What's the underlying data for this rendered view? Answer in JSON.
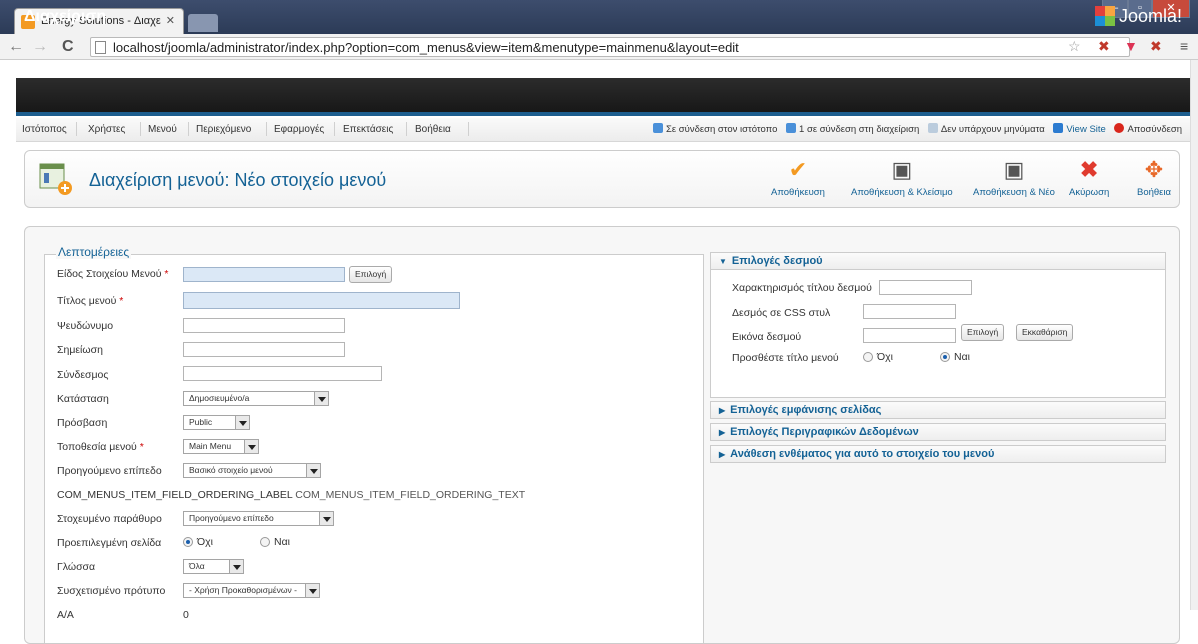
{
  "browser": {
    "tab_title": "Energy Solutions - Διαχείρ",
    "url": "localhost/joomla/administrator/index.php?option=com_menus&view=item&menutype=mainmenu&layout=edit"
  },
  "header": {
    "title": "Διαχείριση",
    "logo_text": "Joomla!"
  },
  "menubar": {
    "items": [
      "Ιστότοπος",
      "Χρήστες",
      "Μενού",
      "Περιεχόμενο",
      "Εφαρμογές",
      "Επεκτάσεις",
      "Βοήθεια"
    ],
    "status": {
      "online_site": "Σε σύνδεση στον ιστότοπο",
      "online_admin": "1 σε σύνδεση στη διαχείριση",
      "messages": "Δεν υπάρχουν μηνύματα",
      "view_site": "View Site",
      "logout": "Αποσύνδεση"
    }
  },
  "toolbar": {
    "page_title": "Διαχείριση μενού: Νέο στοιχείο μενού",
    "save": "Αποθήκευση",
    "save_close": "Αποθήκευση & Κλείσιμο",
    "save_new": "Αποθήκευση & Νέο",
    "cancel": "Ακύρωση",
    "help": "Βοήθεια"
  },
  "details": {
    "legend": "Λεπτομέρειες",
    "item_type_label": "Είδος Στοιχείου Μενού",
    "select_button": "Επιλογή",
    "title_label": "Τίτλος μενού",
    "alias_label": "Ψευδώνυμο",
    "note_label": "Σημείωση",
    "link_label": "Σύνδεσμος",
    "status_label": "Κατάσταση",
    "status_value": "Δημοσιευμένο/a",
    "access_label": "Πρόσβαση",
    "access_value": "Public",
    "menu_location_label": "Τοποθεσία μενού",
    "menu_location_value": "Main Menu",
    "parent_label": "Προηγούμενο επίπεδο",
    "parent_value": "Βασικό στοιχείο μενού",
    "ordering_label": "COM_MENUS_ITEM_FIELD_ORDERING_LABEL",
    "ordering_text": "COM_MENUS_ITEM_FIELD_ORDERING_TEXT",
    "target_window_label": "Στοχευμένο παράθυρο",
    "target_window_value": "Προηγούμενο επίπεδο",
    "default_page_label": "Προεπιλεγμένη σελίδα",
    "no": "Όχι",
    "yes": "Ναι",
    "language_label": "Γλώσσα",
    "language_value": "Όλα",
    "template_style_label": "Συσχετισμένο πρότυπο",
    "template_style_value": "- Χρήση Προκαθορισμένων -",
    "id_label": "Α/Α",
    "id_value": "0"
  },
  "link_options": {
    "heading": "Επιλογές δεσμού",
    "title_attr_label": "Χαρακτηρισμός τίτλου δεσμού",
    "css_label": "Δεσμός σε CSS στυλ",
    "image_label": "Εικόνα δεσμού",
    "select_button": "Επιλογή",
    "clear_button": "Εκκαθάριση",
    "add_title_label": "Προσθέστε τίτλο μενού",
    "no": "Όχι",
    "yes": "Ναι"
  },
  "panels": [
    "Επιλογές εμφάνισης σελίδας",
    "Επιλογές Περιγραφικών Δεδομένων",
    "Ανάθεση ενθέματος για αυτό το στοιχείο του μενού"
  ]
}
